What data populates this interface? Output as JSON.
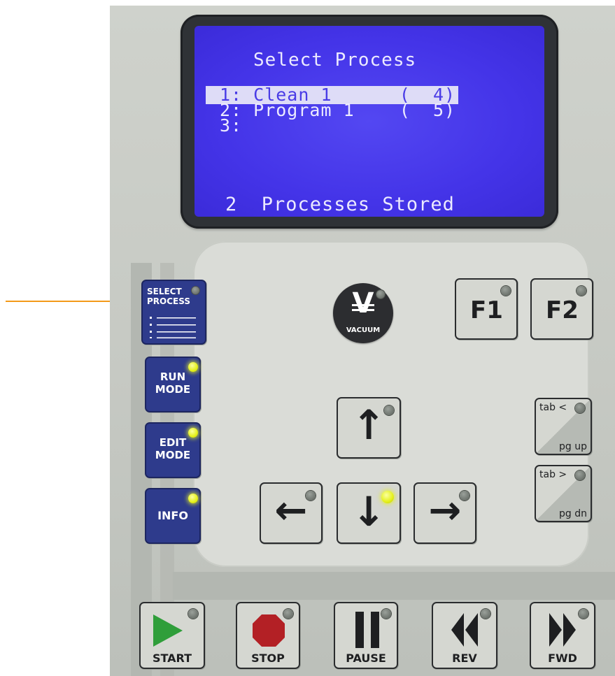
{
  "display": {
    "title": "Select Process",
    "rows": [
      {
        "text": "1: Clean_1      (  4)",
        "selected": true
      },
      {
        "text": "2: Program 1    (  5)",
        "selected": false
      },
      {
        "text": "3:",
        "selected": false
      }
    ],
    "footer": "2  Processes Stored"
  },
  "left_buttons": {
    "select_process": {
      "line1": "SELECT",
      "line2": "PROCESS"
    },
    "run_mode": {
      "line1": "RUN",
      "line2": "MODE"
    },
    "edit_mode": {
      "line1": "EDIT",
      "line2": "MODE"
    },
    "info": {
      "label": "INFO"
    }
  },
  "vacuum": {
    "label": "VACUUM",
    "symbol": "V"
  },
  "function_keys": {
    "f1": "F1",
    "f2": "F2"
  },
  "nav": {
    "up": "↑",
    "down": "↓",
    "left": "←",
    "right": "→"
  },
  "paging": {
    "tab_back": "tab <",
    "pg_up": "pg up",
    "tab_fwd": "tab >",
    "pg_dn": "pg dn"
  },
  "transport": {
    "start": "START",
    "stop": "STOP",
    "pause": "PAUSE",
    "rev": "REV",
    "fwd": "FWD"
  },
  "colors": {
    "lcd_background": "#4434e8",
    "lcd_text": "#eceaff",
    "led_on": "#e4f019",
    "blue_button": "#2e3b8c",
    "pointer_arrow": "#f39a1a",
    "start_green": "#2f9e3a",
    "stop_red": "#b32025"
  },
  "led_states": {
    "select_process": "off",
    "run_mode": "on",
    "edit_mode": "on",
    "info": "on",
    "down": "on"
  }
}
